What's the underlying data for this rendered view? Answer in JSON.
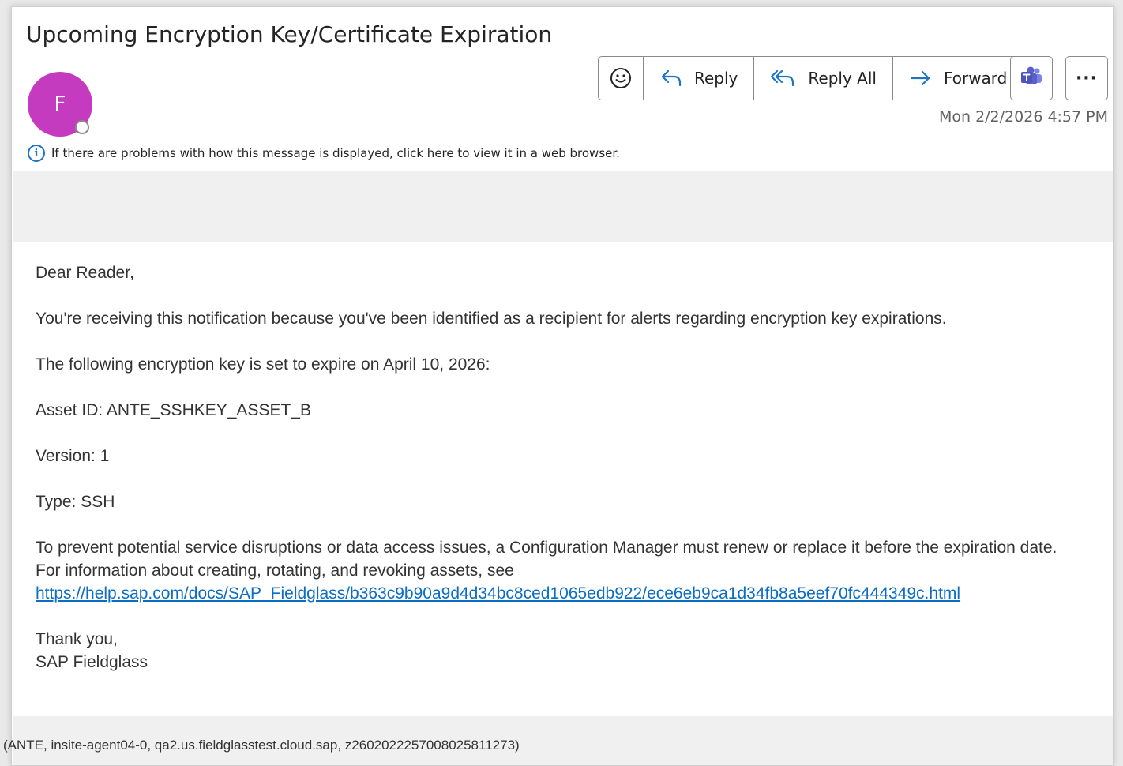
{
  "email": {
    "subject": "Upcoming Encryption Key/Certificate Expiration",
    "sender_initial": "F",
    "date": "Mon 2/2/2026 4:57 PM",
    "info_message": "If there are problems with how this message is displayed, click here to view it in a web browser."
  },
  "toolbar": {
    "reply_label": "Reply",
    "reply_all_label": "Reply All",
    "forward_label": "Forward",
    "more_label": "···"
  },
  "body": {
    "greeting": "Dear Reader,",
    "paragraph1": "You're receiving this notification because you've been identified as a recipient for alerts regarding encryption key expirations.",
    "paragraph2": "The following encryption key is set to expire on April 10, 2026:",
    "asset_id": "Asset ID: ANTE_SSHKEY_ASSET_B",
    "version": "Version: 1",
    "type": "Type: SSH",
    "paragraph3": "To prevent potential service disruptions or data access issues, a Configuration Manager must renew or replace it before the expiration date.",
    "paragraph4": "For information about creating, rotating, and revoking assets, see",
    "link": "https://help.sap.com/docs/SAP_Fieldglass/b363c9b90a9d4d34bc8ced1065edb922/ece6eb9ca1d34fb8a5eef70fc444349c.html",
    "closing": "Thank you,",
    "signature": "SAP Fieldglass"
  },
  "footer": {
    "trace": "(ANTE, insite-agent04-0, qa2.us.fieldglasstest.cloud.sap, z2602022257008025811273)"
  },
  "colors": {
    "avatar": "#c43bc0",
    "link": "#0b6dc4",
    "accent_blue": "#1e74c4",
    "teams": "#5b5fc7"
  },
  "icons": [
    "smiley-icon",
    "reply-icon",
    "reply-all-icon",
    "forward-icon",
    "teams-icon",
    "info-icon"
  ]
}
